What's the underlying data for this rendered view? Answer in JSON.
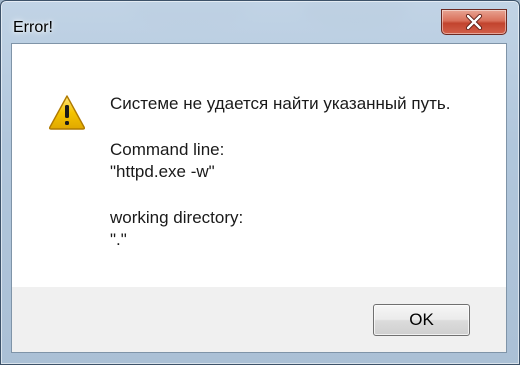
{
  "window": {
    "title": "Error!"
  },
  "icons": {
    "warning": "warning-icon",
    "close": "close-icon"
  },
  "message": {
    "error_text": "Системе не удается найти указанный путь.",
    "command_label": "Command line:",
    "command_value": "\"httpd.exe -w\"",
    "directory_label": "working directory:",
    "directory_value": "\".\""
  },
  "buttons": {
    "ok_label": "OK"
  },
  "colors": {
    "close_button": "#c2442e",
    "warning_fill": "#f5c400",
    "content_background": "#ffffff",
    "button_area_background": "#f0f0f0"
  }
}
